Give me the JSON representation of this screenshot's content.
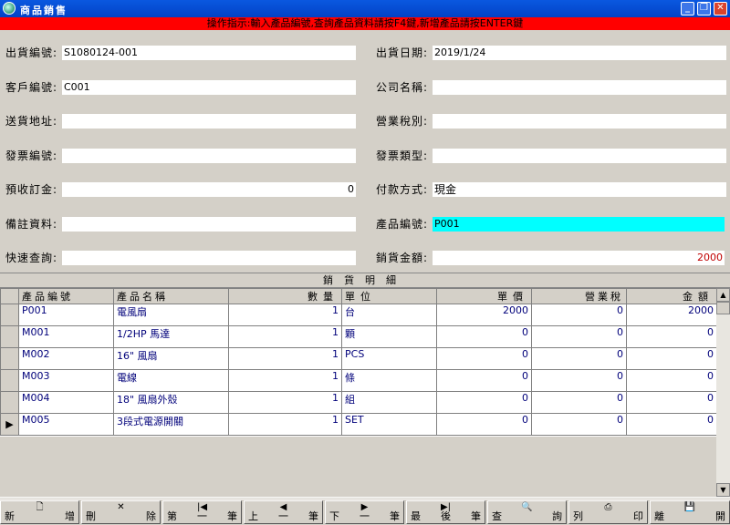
{
  "window": {
    "title": "商品銷售"
  },
  "instruction": "操作指示:輸入產品編號,查詢產品資料請按F4鍵,新增產品請按ENTER鍵",
  "form": {
    "order_no_label": "出貨編號:",
    "order_no": "S1080124-001",
    "ship_date_label": "出貨日期:",
    "ship_date": "2019/1/24",
    "customer_no_label": "客戶編號:",
    "customer_no": "C001",
    "company_label": "公司名稱:",
    "company": "",
    "address_label": "送貨地址:",
    "address": "",
    "tax_type_label": "營業稅別:",
    "tax_type": "",
    "invoice_no_label": "發票編號:",
    "invoice_no": "",
    "invoice_type_label": "發票類型:",
    "invoice_type": "",
    "deposit_label": "預收訂金:",
    "deposit": "0",
    "payment_label": "付款方式:",
    "payment": "現金",
    "remark_label": "備註資料:",
    "remark": "",
    "product_no_label": "產品編號:",
    "product_no": "P001",
    "quick_search_label": "快速查詢:",
    "quick_search": "",
    "sales_amount_label": "銷貨金額:",
    "sales_amount": "2000"
  },
  "grid": {
    "title": "銷貨明細",
    "columns": [
      "產品編號",
      "產品名稱",
      "數量",
      "單位",
      "單價",
      "營業稅",
      "金額"
    ],
    "rows": [
      {
        "code": "P001",
        "name": "電風扇",
        "qty": "1",
        "unit": "台",
        "price": "2000",
        "tax": "0",
        "amount": "2000"
      },
      {
        "code": "M001",
        "name": "1/2HP 馬達",
        "qty": "1",
        "unit": "顆",
        "price": "0",
        "tax": "0",
        "amount": "0"
      },
      {
        "code": "M002",
        "name": "16\" 風扇",
        "qty": "1",
        "unit": "PCS",
        "price": "0",
        "tax": "0",
        "amount": "0"
      },
      {
        "code": "M003",
        "name": "電線",
        "qty": "1",
        "unit": "條",
        "price": "0",
        "tax": "0",
        "amount": "0"
      },
      {
        "code": "M004",
        "name": "18\" 風扇外殼",
        "qty": "1",
        "unit": "組",
        "price": "0",
        "tax": "0",
        "amount": "0"
      },
      {
        "code": "M005",
        "name": "3段式電源開關",
        "qty": "1",
        "unit": "SET",
        "price": "0",
        "tax": "0",
        "amount": "0"
      }
    ],
    "current_row_marker": "▶"
  },
  "toolbar": {
    "new_a": "新",
    "new_b": "增",
    "delete_a": "刪",
    "delete_b": "除",
    "first_a": "第",
    "first_b": "一",
    "first_c": "筆",
    "prev_a": "上",
    "prev_b": "一",
    "prev_c": "筆",
    "next_a": "下",
    "next_b": "一",
    "next_c": "筆",
    "last_a": "最",
    "last_b": "後",
    "last_c": "筆",
    "query_a": "查",
    "query_b": "詢",
    "print_a": "列",
    "print_b": "印",
    "exit_a": "離",
    "exit_b": "開"
  }
}
